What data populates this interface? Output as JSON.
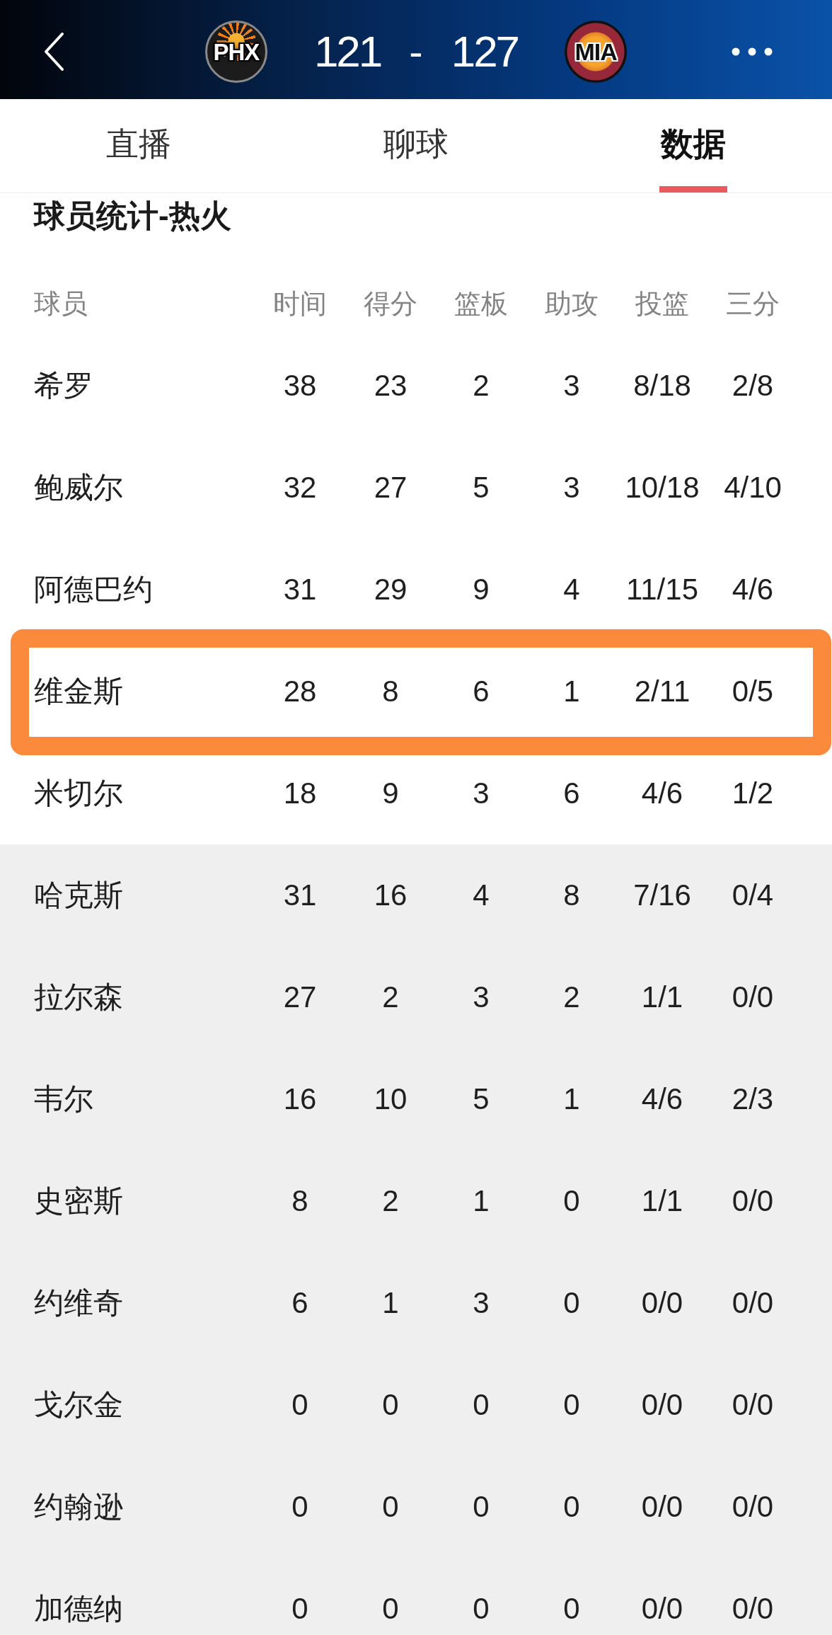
{
  "scoreboard": {
    "teams": [
      {
        "abbr": "PHX",
        "score": "121",
        "kind": "sunburst"
      },
      {
        "abbr": "MIA",
        "score": "127",
        "kind": "ring"
      }
    ],
    "separator": "-"
  },
  "tabs": [
    {
      "label": "直播",
      "selected": false
    },
    {
      "label": "聊球",
      "selected": false
    },
    {
      "label": "数据",
      "selected": true
    }
  ],
  "section_title": "球员统计-热火",
  "table": {
    "columns": [
      "球员",
      "时间",
      "得分",
      "篮板",
      "助攻",
      "投篮",
      "三分"
    ],
    "rows": [
      {
        "cells": [
          "希罗",
          "38",
          "23",
          "2",
          "3",
          "8/18",
          "2/8"
        ],
        "shaded": false,
        "marked": false
      },
      {
        "cells": [
          "鲍威尔",
          "32",
          "27",
          "5",
          "3",
          "10/18",
          "4/10"
        ],
        "shaded": false,
        "marked": false
      },
      {
        "cells": [
          "阿德巴约",
          "31",
          "29",
          "9",
          "4",
          "11/15",
          "4/6"
        ],
        "shaded": false,
        "marked": false
      },
      {
        "cells": [
          "维金斯",
          "28",
          "8",
          "6",
          "1",
          "2/11",
          "0/5"
        ],
        "shaded": false,
        "marked": true
      },
      {
        "cells": [
          "米切尔",
          "18",
          "9",
          "3",
          "6",
          "4/6",
          "1/2"
        ],
        "shaded": false,
        "marked": false
      },
      {
        "cells": [
          "哈克斯",
          "31",
          "16",
          "4",
          "8",
          "7/16",
          "0/4"
        ],
        "shaded": true,
        "marked": false
      },
      {
        "cells": [
          "拉尔森",
          "27",
          "2",
          "3",
          "2",
          "1/1",
          "0/0"
        ],
        "shaded": true,
        "marked": false
      },
      {
        "cells": [
          "韦尔",
          "16",
          "10",
          "5",
          "1",
          "4/6",
          "2/3"
        ],
        "shaded": true,
        "marked": false
      },
      {
        "cells": [
          "史密斯",
          "8",
          "2",
          "1",
          "0",
          "1/1",
          "0/0"
        ],
        "shaded": true,
        "marked": false
      },
      {
        "cells": [
          "约维奇",
          "6",
          "1",
          "3",
          "0",
          "0/0",
          "0/0"
        ],
        "shaded": true,
        "marked": false
      },
      {
        "cells": [
          "戈尔金",
          "0",
          "0",
          "0",
          "0",
          "0/0",
          "0/0"
        ],
        "shaded": true,
        "marked": false
      },
      {
        "cells": [
          "约翰逊",
          "0",
          "0",
          "0",
          "0",
          "0/0",
          "0/0"
        ],
        "shaded": true,
        "marked": false
      },
      {
        "cells": [
          "加德纳",
          "0",
          "0",
          "0",
          "0",
          "0/0",
          "0/0"
        ],
        "shaded": true,
        "marked": false
      }
    ]
  }
}
